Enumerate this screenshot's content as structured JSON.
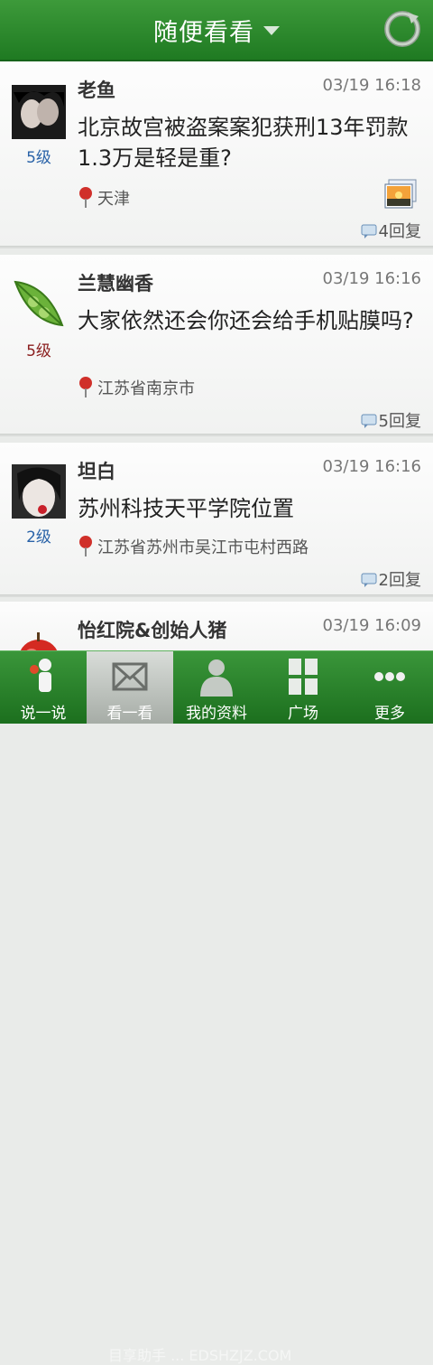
{
  "header": {
    "title": "随便看看"
  },
  "feed": [
    {
      "username": "老鱼",
      "time": "03/19 16:18",
      "level": "5级",
      "level_color": "#2a63a8",
      "content": "北京故宫被盗案案犯获刑13年罚款1.3万是轻是重?",
      "location": "天津",
      "replies": "4回复",
      "has_image": true
    },
    {
      "username": "兰慧幽香",
      "time": "03/19 16:16",
      "level": "5级",
      "level_color": "#8b2020",
      "content": "大家依然还会你还会给手机贴膜吗?",
      "location": "江苏省南京市",
      "replies": "5回复",
      "has_image": false
    },
    {
      "username": "坦白",
      "time": "03/19 16:16",
      "level": "2级",
      "level_color": "#2a63a8",
      "content": "苏州科技天平学院位置",
      "location": "江苏省苏州市吴江市屯村西路",
      "replies": "2回复",
      "has_image": false
    },
    {
      "username": "怡红院&创始人猪",
      "time": "03/19 16:09"
    }
  ],
  "tabs": [
    {
      "label": "说一说",
      "icon": "speaker-person-icon"
    },
    {
      "label": "看一看",
      "icon": "envelope-icon",
      "active": true
    },
    {
      "label": "我的资料",
      "icon": "profile-icon"
    },
    {
      "label": "广场",
      "icon": "grid-icon"
    },
    {
      "label": "更多",
      "icon": "more-dots-icon"
    }
  ],
  "watermark": "目享助手 ... EDSHZJZ.COM",
  "colors": {
    "header_green": "#2a8a2c",
    "tab_green": "#2b862c"
  }
}
